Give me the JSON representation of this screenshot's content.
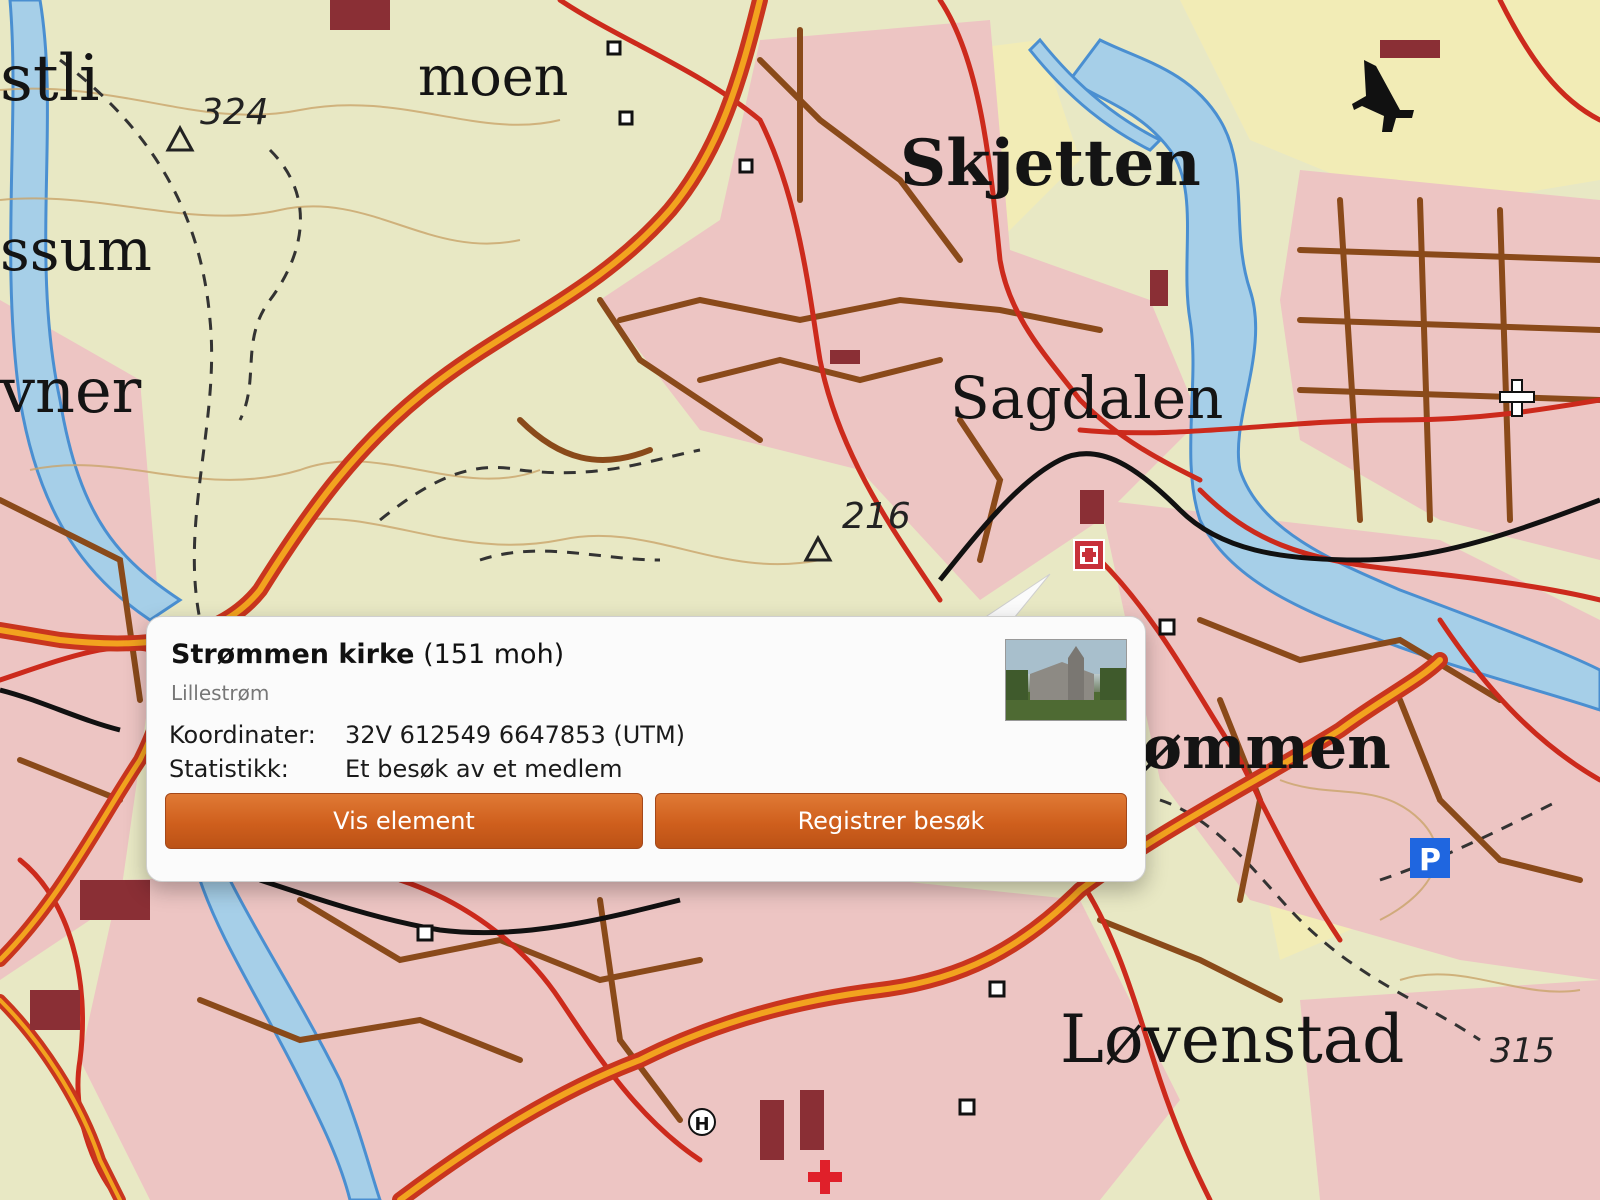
{
  "map": {
    "places": [
      {
        "id": "stli",
        "text": "stli"
      },
      {
        "id": "moen",
        "text": "moen"
      },
      {
        "id": "ssum",
        "text": "ssum"
      },
      {
        "id": "vner",
        "text": "vner"
      },
      {
        "id": "skjetten",
        "text": "Skjetten"
      },
      {
        "id": "sagdalen",
        "text": "Sagdalen"
      },
      {
        "id": "strommen",
        "text": "ømmen"
      },
      {
        "id": "lovenstad",
        "text": "Løvenstad"
      }
    ],
    "elevations": [
      {
        "id": "e324",
        "text": "324"
      },
      {
        "id": "e216",
        "text": "216"
      },
      {
        "id": "e315",
        "text": "315"
      }
    ],
    "symbols": [
      "parking-icon",
      "airport-icon",
      "hospital-icon",
      "church-icon",
      "summit-icon"
    ],
    "parking_letter": "P",
    "hospital_letter": "H",
    "colors": {
      "road": "#c9351e",
      "road_major": "#f2a31f",
      "track": "#8a4a1a",
      "water": "#9ec9e6",
      "urban": "#ecc6c4",
      "forest": "#e6e8c3",
      "open": "#f3ecb8"
    }
  },
  "popup": {
    "title": "Strømmen kirke",
    "elevation": "(151 moh)",
    "subtitle": "Lillestrøm",
    "coords_label": "Koordinater:",
    "coords_value": "32V 612549 6647853 (UTM)",
    "stats_label": "Statistikk:",
    "stats_value": "Et besøk av et medlem",
    "view_button": "Vis element",
    "register_button": "Registrer besøk"
  }
}
